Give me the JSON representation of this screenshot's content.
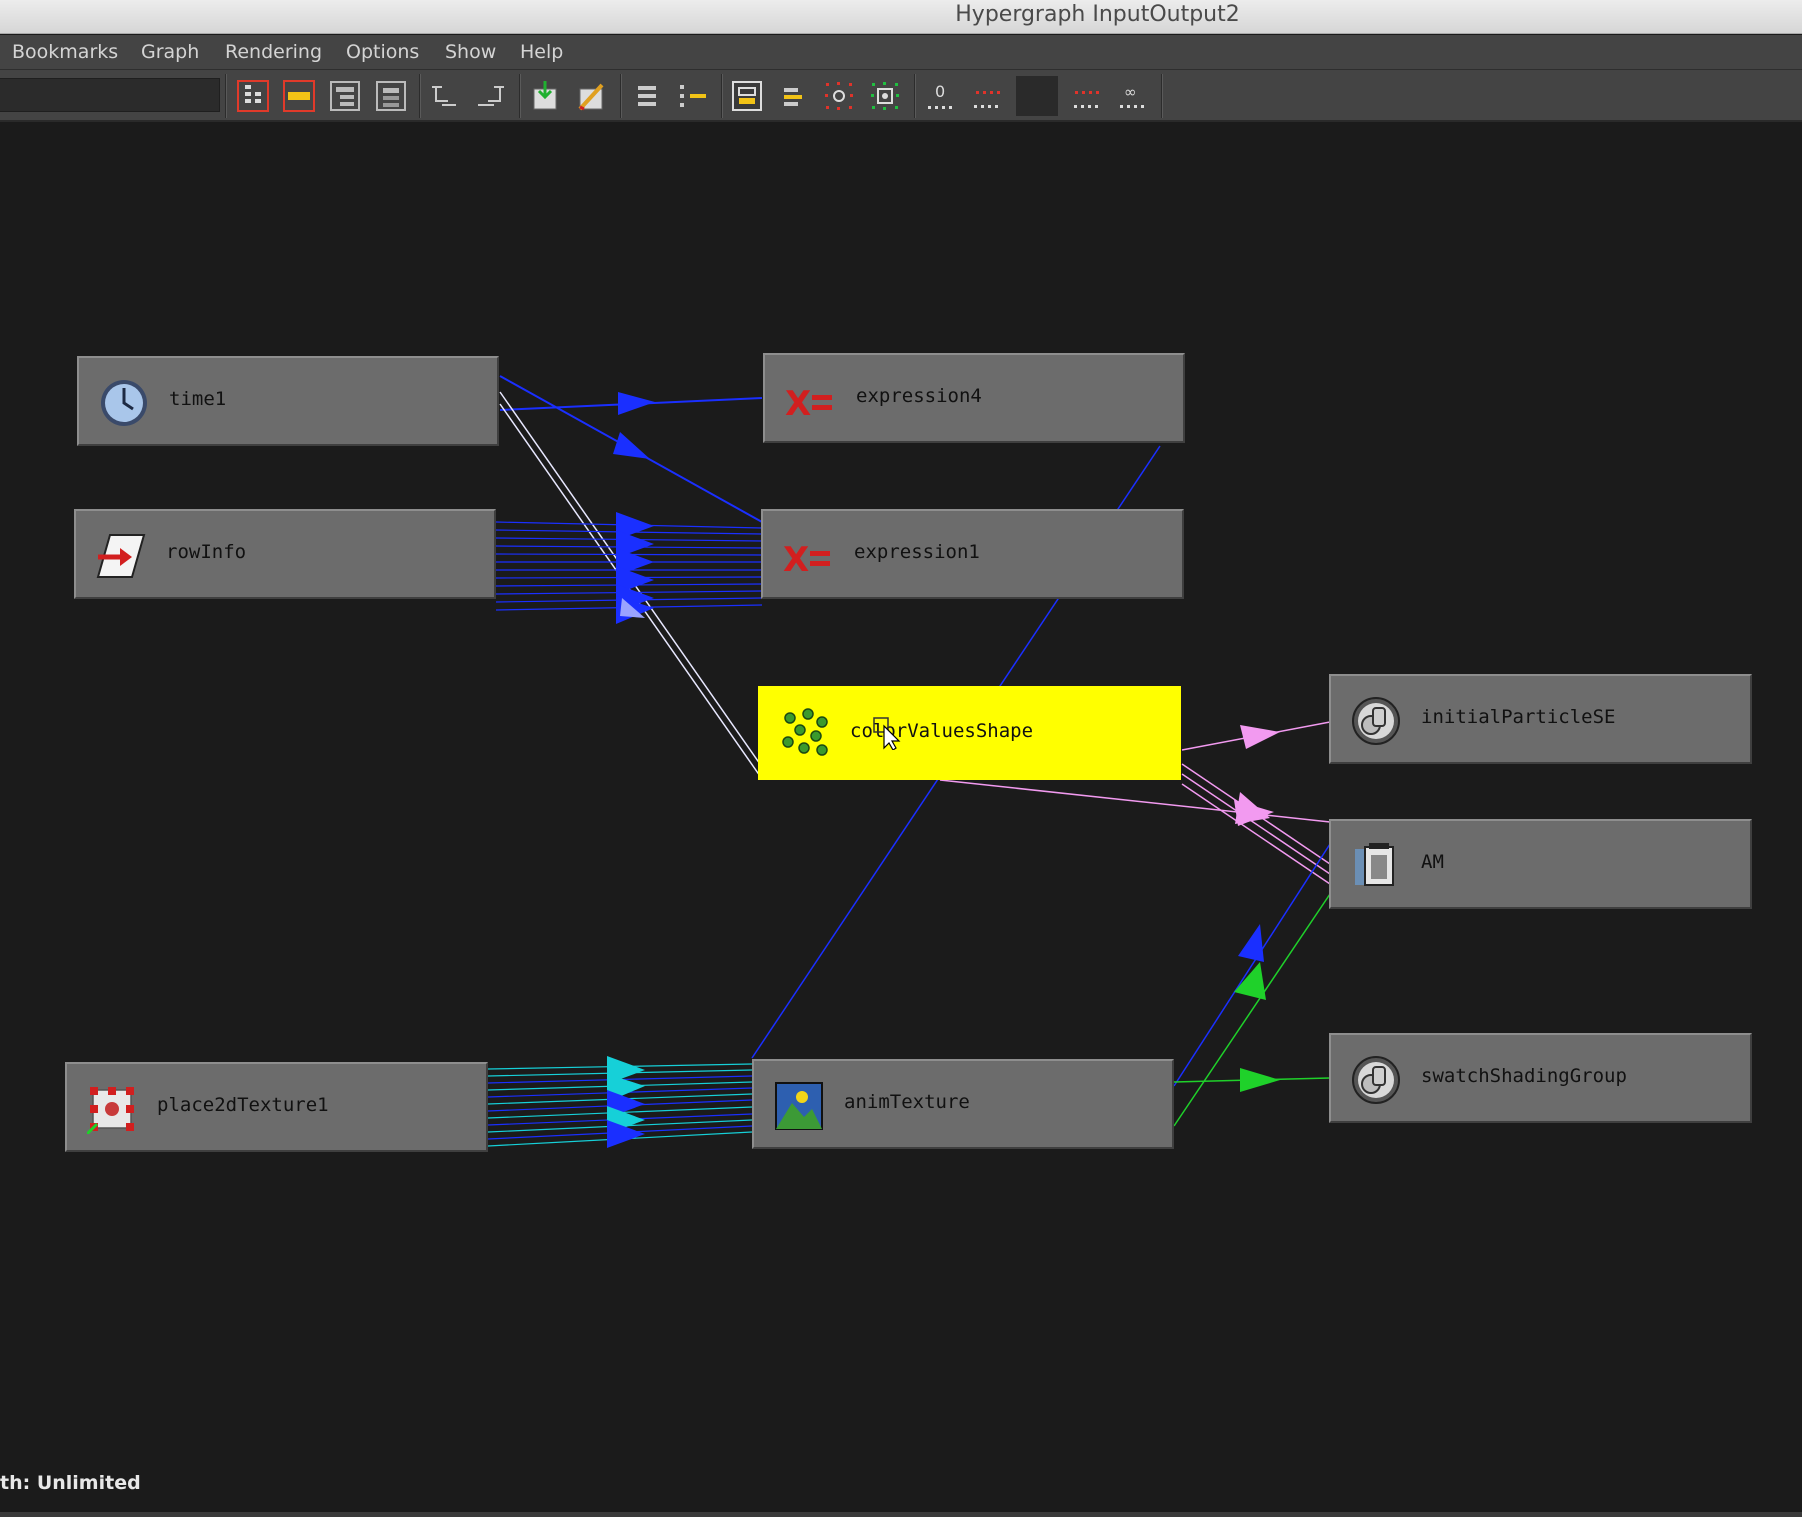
{
  "window": {
    "title": "Hypergraph InputOutput2"
  },
  "menu": {
    "items": [
      "Bookmarks",
      "Graph",
      "Rendering",
      "Options",
      "Show",
      "Help"
    ]
  },
  "toolbar": {
    "search_value": "",
    "buttons": [
      "frame-hierarchy-icon",
      "frame-branch-icon",
      "scene-hierarchy-icon",
      "input-output-connections-icon",
      "graph-up-icon",
      "graph-down-icon",
      "add-selected-icon",
      "remove-selected-icon",
      "simple-layout-icon",
      "tree-layout-icon",
      "node-swatch-icon",
      "toggle-label-icon",
      "show-shapes-icon",
      "show-connected-icon",
      "clear-graph-icon",
      "remove-unused-icon",
      "color-swatch-icon",
      "graph-layout-icon",
      "reset-layout-icon"
    ]
  },
  "nodes": [
    {
      "id": "time1",
      "label": "time1",
      "icon": "clock-icon"
    },
    {
      "id": "expression4",
      "label": "expression4",
      "icon": "expression-icon"
    },
    {
      "id": "rowInfo",
      "label": "rowInfo",
      "icon": "arrow-node-icon"
    },
    {
      "id": "expression1",
      "label": "expression1",
      "icon": "expression-icon"
    },
    {
      "id": "colorValuesShape",
      "label": "colorValuesShape",
      "icon": "particle-icon",
      "selected": true
    },
    {
      "id": "initialParticleSE",
      "label": "initialParticleSE",
      "icon": "shading-group-icon"
    },
    {
      "id": "AM",
      "label": "AM",
      "icon": "asset-icon"
    },
    {
      "id": "place2dTexture1",
      "label": "place2dTexture1",
      "icon": "place2d-texture-icon"
    },
    {
      "id": "animTexture",
      "label": "animTexture",
      "icon": "texture-image-icon"
    },
    {
      "id": "swatchShadingGroup",
      "label": "swatchShadingGroup",
      "icon": "shading-group-icon"
    }
  ],
  "status": {
    "text": "th: Unlimited"
  },
  "colors": {
    "selected_node": "#ffff00",
    "node_fill": "#6c6c6c",
    "wire_blue": "#1a2fff",
    "wire_cyan": "#16d0d8",
    "wire_pink": "#f29af0",
    "wire_green": "#1fd12a",
    "wire_white": "#e8e8ff"
  }
}
